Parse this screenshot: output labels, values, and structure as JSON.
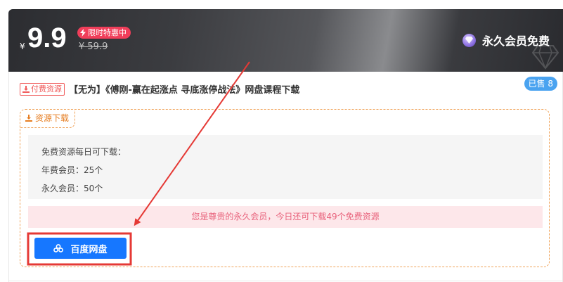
{
  "banner": {
    "currency": "¥",
    "price": "9.9",
    "sale_badge": "限时特惠中",
    "old_price": "¥ 59.9",
    "vip_label": "永久会员免费"
  },
  "post": {
    "sold_badge": "已售 8",
    "paid_tag": "付费资源",
    "title": "【无为】《傅刚-赢在起涨点 寻底涨停战法》网盘课程下载"
  },
  "download": {
    "tab_label": "资源下载",
    "quota_lines": [
      "免费资源每日可下载：",
      "年费会员：25个",
      "永久会员：50个"
    ],
    "notice": "您是尊贵的永久会员，今日还可下载49个免费资源",
    "button_label": "百度网盘"
  },
  "colors": {
    "accent_blue": "#1677ff",
    "sale_red": "#f03e5a",
    "border_orange": "#f0a35a",
    "annotation_red": "#e53935"
  },
  "icons": [
    "bolt-icon",
    "gem-icon",
    "diamond-icon",
    "download-icon",
    "baidu-cloud-icon"
  ]
}
